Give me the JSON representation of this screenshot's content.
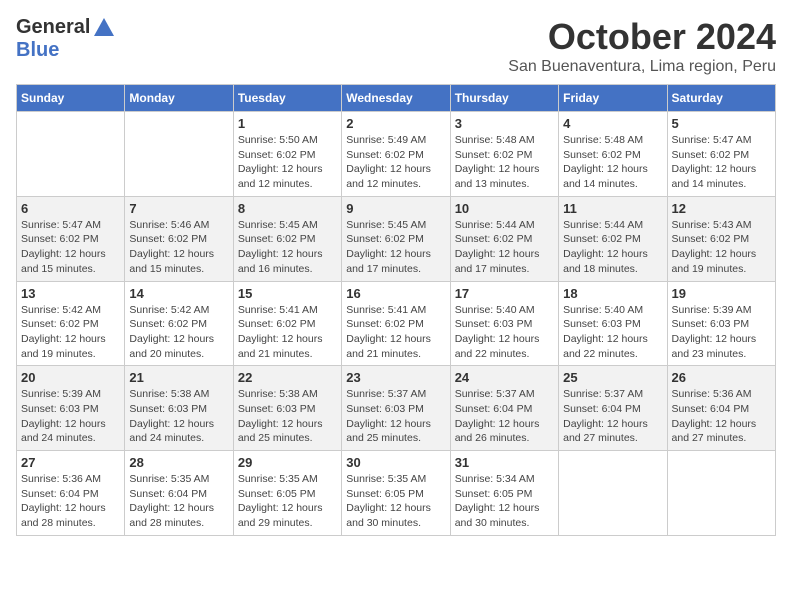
{
  "header": {
    "logo_general": "General",
    "logo_blue": "Blue",
    "month_title": "October 2024",
    "subtitle": "San Buenaventura, Lima region, Peru"
  },
  "weekdays": [
    "Sunday",
    "Monday",
    "Tuesday",
    "Wednesday",
    "Thursday",
    "Friday",
    "Saturday"
  ],
  "weeks": [
    [
      {
        "day": "",
        "info": ""
      },
      {
        "day": "",
        "info": ""
      },
      {
        "day": "1",
        "info": "Sunrise: 5:50 AM\nSunset: 6:02 PM\nDaylight: 12 hours and 12 minutes."
      },
      {
        "day": "2",
        "info": "Sunrise: 5:49 AM\nSunset: 6:02 PM\nDaylight: 12 hours and 12 minutes."
      },
      {
        "day": "3",
        "info": "Sunrise: 5:48 AM\nSunset: 6:02 PM\nDaylight: 12 hours and 13 minutes."
      },
      {
        "day": "4",
        "info": "Sunrise: 5:48 AM\nSunset: 6:02 PM\nDaylight: 12 hours and 14 minutes."
      },
      {
        "day": "5",
        "info": "Sunrise: 5:47 AM\nSunset: 6:02 PM\nDaylight: 12 hours and 14 minutes."
      }
    ],
    [
      {
        "day": "6",
        "info": "Sunrise: 5:47 AM\nSunset: 6:02 PM\nDaylight: 12 hours and 15 minutes."
      },
      {
        "day": "7",
        "info": "Sunrise: 5:46 AM\nSunset: 6:02 PM\nDaylight: 12 hours and 15 minutes."
      },
      {
        "day": "8",
        "info": "Sunrise: 5:45 AM\nSunset: 6:02 PM\nDaylight: 12 hours and 16 minutes."
      },
      {
        "day": "9",
        "info": "Sunrise: 5:45 AM\nSunset: 6:02 PM\nDaylight: 12 hours and 17 minutes."
      },
      {
        "day": "10",
        "info": "Sunrise: 5:44 AM\nSunset: 6:02 PM\nDaylight: 12 hours and 17 minutes."
      },
      {
        "day": "11",
        "info": "Sunrise: 5:44 AM\nSunset: 6:02 PM\nDaylight: 12 hours and 18 minutes."
      },
      {
        "day": "12",
        "info": "Sunrise: 5:43 AM\nSunset: 6:02 PM\nDaylight: 12 hours and 19 minutes."
      }
    ],
    [
      {
        "day": "13",
        "info": "Sunrise: 5:42 AM\nSunset: 6:02 PM\nDaylight: 12 hours and 19 minutes."
      },
      {
        "day": "14",
        "info": "Sunrise: 5:42 AM\nSunset: 6:02 PM\nDaylight: 12 hours and 20 minutes."
      },
      {
        "day": "15",
        "info": "Sunrise: 5:41 AM\nSunset: 6:02 PM\nDaylight: 12 hours and 21 minutes."
      },
      {
        "day": "16",
        "info": "Sunrise: 5:41 AM\nSunset: 6:02 PM\nDaylight: 12 hours and 21 minutes."
      },
      {
        "day": "17",
        "info": "Sunrise: 5:40 AM\nSunset: 6:03 PM\nDaylight: 12 hours and 22 minutes."
      },
      {
        "day": "18",
        "info": "Sunrise: 5:40 AM\nSunset: 6:03 PM\nDaylight: 12 hours and 22 minutes."
      },
      {
        "day": "19",
        "info": "Sunrise: 5:39 AM\nSunset: 6:03 PM\nDaylight: 12 hours and 23 minutes."
      }
    ],
    [
      {
        "day": "20",
        "info": "Sunrise: 5:39 AM\nSunset: 6:03 PM\nDaylight: 12 hours and 24 minutes."
      },
      {
        "day": "21",
        "info": "Sunrise: 5:38 AM\nSunset: 6:03 PM\nDaylight: 12 hours and 24 minutes."
      },
      {
        "day": "22",
        "info": "Sunrise: 5:38 AM\nSunset: 6:03 PM\nDaylight: 12 hours and 25 minutes."
      },
      {
        "day": "23",
        "info": "Sunrise: 5:37 AM\nSunset: 6:03 PM\nDaylight: 12 hours and 25 minutes."
      },
      {
        "day": "24",
        "info": "Sunrise: 5:37 AM\nSunset: 6:04 PM\nDaylight: 12 hours and 26 minutes."
      },
      {
        "day": "25",
        "info": "Sunrise: 5:37 AM\nSunset: 6:04 PM\nDaylight: 12 hours and 27 minutes."
      },
      {
        "day": "26",
        "info": "Sunrise: 5:36 AM\nSunset: 6:04 PM\nDaylight: 12 hours and 27 minutes."
      }
    ],
    [
      {
        "day": "27",
        "info": "Sunrise: 5:36 AM\nSunset: 6:04 PM\nDaylight: 12 hours and 28 minutes."
      },
      {
        "day": "28",
        "info": "Sunrise: 5:35 AM\nSunset: 6:04 PM\nDaylight: 12 hours and 28 minutes."
      },
      {
        "day": "29",
        "info": "Sunrise: 5:35 AM\nSunset: 6:05 PM\nDaylight: 12 hours and 29 minutes."
      },
      {
        "day": "30",
        "info": "Sunrise: 5:35 AM\nSunset: 6:05 PM\nDaylight: 12 hours and 30 minutes."
      },
      {
        "day": "31",
        "info": "Sunrise: 5:34 AM\nSunset: 6:05 PM\nDaylight: 12 hours and 30 minutes."
      },
      {
        "day": "",
        "info": ""
      },
      {
        "day": "",
        "info": ""
      }
    ]
  ]
}
